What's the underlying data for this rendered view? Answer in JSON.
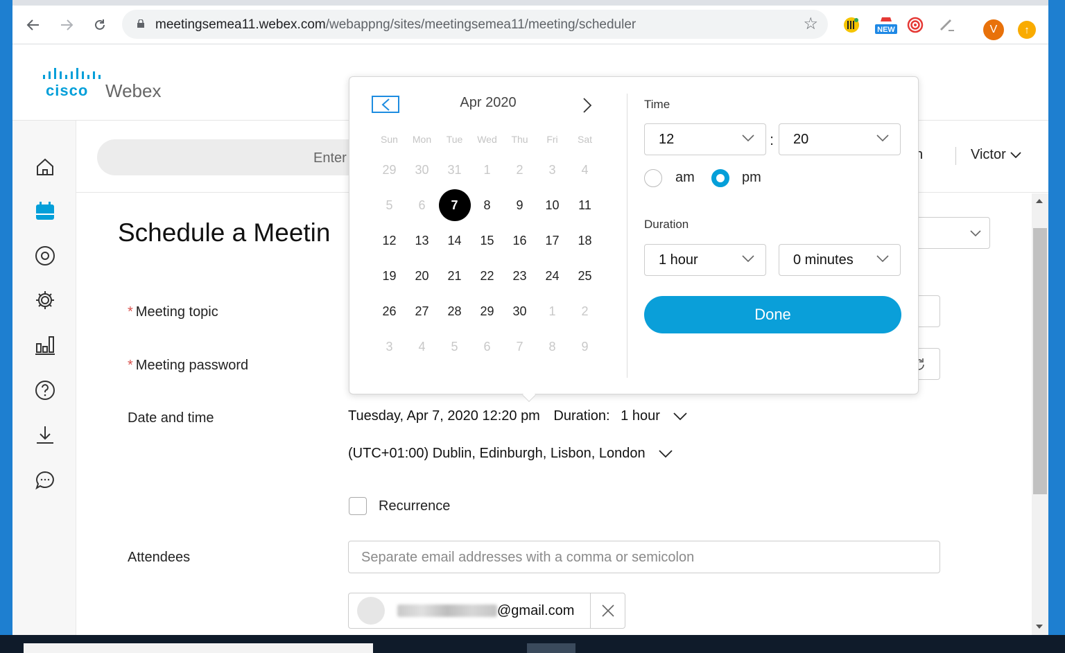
{
  "browser": {
    "url_host": "meetingsemea11.webex.com",
    "url_path": "/webappng/sites/meetingsemea11/meeting/scheduler",
    "extension_badge": "NEW",
    "profile_initial": "V"
  },
  "brand": {
    "cisco": "cisco",
    "product": "Webex"
  },
  "topbar": {
    "search_placeholder": "Enter",
    "language": "glish",
    "user": "Victor"
  },
  "page": {
    "title": "Schedule a Meetin"
  },
  "form": {
    "topic_label": "Meeting topic",
    "password_label": "Meeting password",
    "datetime_label": "Date and time",
    "datetime_value": "Tuesday, Apr 7, 2020 12:20 pm",
    "duration_prefix": "Duration:",
    "duration_value": "1 hour",
    "timezone": "(UTC+01:00) Dublin, Edinburgh, Lisbon, London",
    "recurrence_label": "Recurrence",
    "attendees_label": "Attendees",
    "attendees_placeholder": "Separate email addresses with a comma or semicolon",
    "attendee_email": "@gmail.com",
    "required_mark": "*"
  },
  "picker": {
    "month": "Apr 2020",
    "weekdays": [
      "Sun",
      "Mon",
      "Tue",
      "Wed",
      "Thu",
      "Fri",
      "Sat"
    ],
    "weeks": [
      [
        {
          "d": "29",
          "m": true
        },
        {
          "d": "30",
          "m": true
        },
        {
          "d": "31",
          "m": true
        },
        {
          "d": "1",
          "m": true
        },
        {
          "d": "2",
          "m": true
        },
        {
          "d": "3",
          "m": true
        },
        {
          "d": "4",
          "m": true
        }
      ],
      [
        {
          "d": "5",
          "m": true
        },
        {
          "d": "6",
          "m": true
        },
        {
          "d": "7",
          "s": true
        },
        {
          "d": "8"
        },
        {
          "d": "9"
        },
        {
          "d": "10"
        },
        {
          "d": "11"
        }
      ],
      [
        {
          "d": "12"
        },
        {
          "d": "13"
        },
        {
          "d": "14"
        },
        {
          "d": "15"
        },
        {
          "d": "16"
        },
        {
          "d": "17"
        },
        {
          "d": "18"
        }
      ],
      [
        {
          "d": "19"
        },
        {
          "d": "20"
        },
        {
          "d": "21"
        },
        {
          "d": "22"
        },
        {
          "d": "23"
        },
        {
          "d": "24"
        },
        {
          "d": "25"
        }
      ],
      [
        {
          "d": "26"
        },
        {
          "d": "27"
        },
        {
          "d": "28"
        },
        {
          "d": "29"
        },
        {
          "d": "30"
        },
        {
          "d": "1",
          "m": true
        },
        {
          "d": "2",
          "m": true
        }
      ],
      [
        {
          "d": "3",
          "m": true
        },
        {
          "d": "4",
          "m": true
        },
        {
          "d": "5",
          "m": true
        },
        {
          "d": "6",
          "m": true
        },
        {
          "d": "7",
          "m": true
        },
        {
          "d": "8",
          "m": true
        },
        {
          "d": "9",
          "m": true
        }
      ]
    ],
    "time_label": "Time",
    "hour": "12",
    "minute": "20",
    "colon": ":",
    "am_label": "am",
    "pm_label": "pm",
    "selected_period": "pm",
    "duration_label": "Duration",
    "duration_hours": "1 hour",
    "duration_minutes": "0 minutes",
    "done_label": "Done"
  },
  "colors": {
    "accent": "#0a9fd9",
    "brand": "#049fd9",
    "required": "#d9534f"
  }
}
